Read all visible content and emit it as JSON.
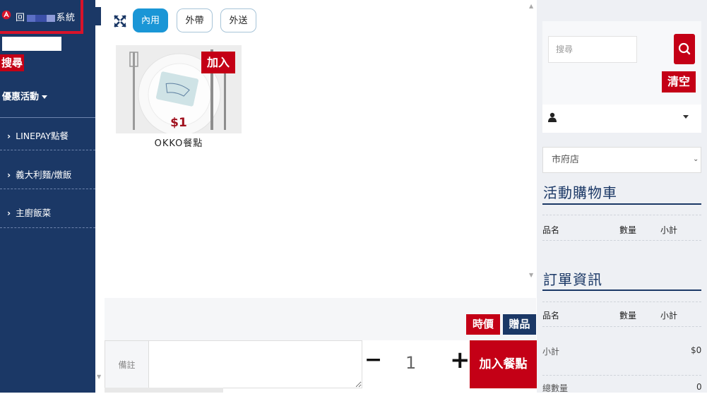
{
  "app": {
    "title_prefix": "回",
    "title_suffix": "系統"
  },
  "sidebar": {
    "search_value": "",
    "search_button": "搜尋",
    "promo_toggle": "優惠活動",
    "items": [
      {
        "label": "LINEPAY點餐"
      },
      {
        "label": "義大利麵/燉飯"
      },
      {
        "label": "主廚飯菜"
      }
    ]
  },
  "order_type_tabs": [
    {
      "label": "內用",
      "active": true
    },
    {
      "label": "外帶",
      "active": false
    },
    {
      "label": "外送",
      "active": false
    }
  ],
  "products": [
    {
      "name": "OKKO餐點",
      "price": "$1",
      "add_label": "加入"
    }
  ],
  "actions": {
    "market_price": "時價",
    "gift": "贈品",
    "note_label": "備註",
    "note_value": "",
    "qty_minus": "−",
    "qty_value": "1",
    "qty_plus": "+",
    "add_meal": "加入餐點"
  },
  "member": {
    "search_placeholder": "搜尋",
    "clear_label": "清空",
    "user_value": ""
  },
  "store": {
    "selected": "市府店"
  },
  "promo_cart": {
    "title": "活動購物車",
    "columns": [
      "品名",
      "數量",
      "小計"
    ]
  },
  "order_info": {
    "title": "訂單資訊",
    "columns": [
      "品名",
      "數量",
      "小計"
    ],
    "subtotal_label": "小計",
    "subtotal_value": "$0",
    "count_label": "總數量",
    "count_value": "0"
  },
  "colors": {
    "sidebar_bg": "#1b3866",
    "accent_red": "#c40016",
    "tab_blue": "#1a96d6",
    "navy": "#1b3866"
  }
}
